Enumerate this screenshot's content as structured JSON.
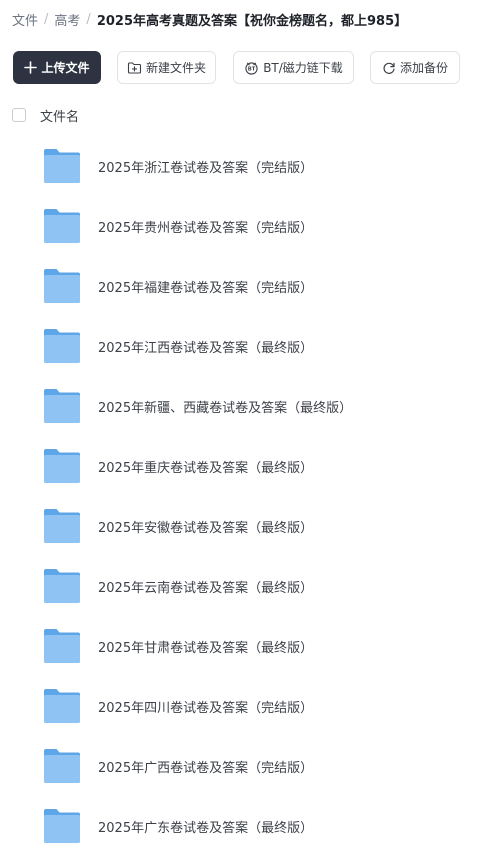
{
  "breadcrumb": {
    "items": [
      "文件",
      "高考"
    ],
    "separator": "/",
    "current": "2025年高考真题及答案【祝你金榜题名，都上985】"
  },
  "toolbar": {
    "upload_label": "上传文件",
    "new_folder_label": "新建文件夹",
    "bt_label": "BT/磁力链下载",
    "backup_label": "添加备份"
  },
  "list_header": {
    "name_column": "文件名"
  },
  "files": [
    {
      "name": "2025年浙江卷试卷及答案（完结版）",
      "type": "folder"
    },
    {
      "name": "2025年贵州卷试卷及答案（完结版）",
      "type": "folder"
    },
    {
      "name": "2025年福建卷试卷及答案（完结版）",
      "type": "folder"
    },
    {
      "name": "2025年江西卷试卷及答案（最终版）",
      "type": "folder"
    },
    {
      "name": "2025年新疆、西藏卷试卷及答案（最终版）",
      "type": "folder"
    },
    {
      "name": "2025年重庆卷试卷及答案（最终版）",
      "type": "folder"
    },
    {
      "name": "2025年安徽卷试卷及答案（最终版）",
      "type": "folder"
    },
    {
      "name": "2025年云南卷试卷及答案（最终版）",
      "type": "folder"
    },
    {
      "name": "2025年甘肃卷试卷及答案（最终版）",
      "type": "folder"
    },
    {
      "name": "2025年四川卷试卷及答案（完结版）",
      "type": "folder"
    },
    {
      "name": "2025年广西卷试卷及答案（完结版）",
      "type": "folder"
    },
    {
      "name": "2025年广东卷试卷及答案（最终版）",
      "type": "folder"
    }
  ],
  "colors": {
    "primary_button": "#2d3340",
    "folder_front": "#8ec3f3",
    "folder_back": "#5fa6e8",
    "text": "#3c4048"
  },
  "icons": {
    "upload": "plus-icon",
    "new_folder": "new-folder-icon",
    "bt": "bt-icon",
    "backup": "refresh-icon",
    "file": "folder-icon"
  }
}
